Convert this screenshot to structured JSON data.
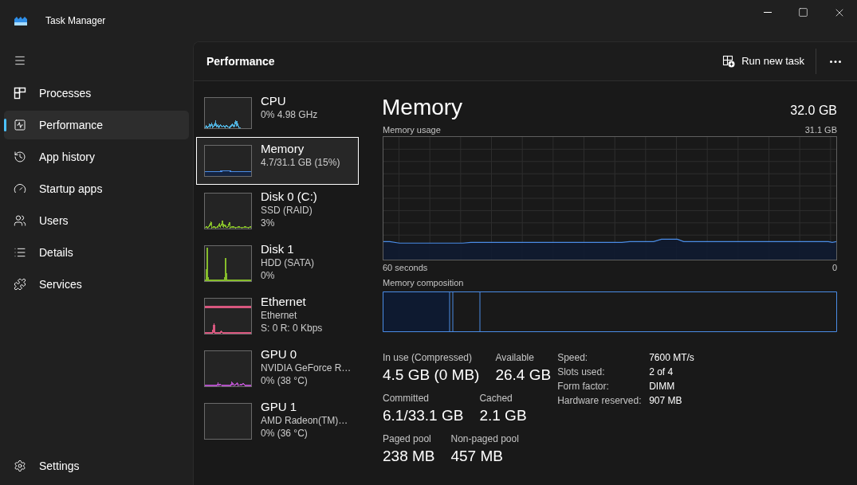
{
  "window": {
    "title": "Task Manager"
  },
  "sidebar": {
    "items": [
      {
        "label": "Processes",
        "selected": false
      },
      {
        "label": "Performance",
        "selected": true
      },
      {
        "label": "App history",
        "selected": false
      },
      {
        "label": "Startup apps",
        "selected": false
      },
      {
        "label": "Users",
        "selected": false
      },
      {
        "label": "Details",
        "selected": false
      },
      {
        "label": "Services",
        "selected": false
      }
    ],
    "settings": {
      "label": "Settings"
    }
  },
  "header": {
    "title": "Performance",
    "run_new_task": {
      "label": "Run new task"
    }
  },
  "devices": [
    {
      "name": "CPU",
      "details": [
        "0% 4.98 GHz"
      ],
      "color": "#4fb0dc",
      "selected": false
    },
    {
      "name": "Memory",
      "details": [
        "4.7/31.1 GB (15%)"
      ],
      "color": "#4a8ce6",
      "selected": true
    },
    {
      "name": "Disk 0 (C:)",
      "details": [
        "SSD (RAID)",
        "3%"
      ],
      "color": "#86bd2b",
      "selected": false
    },
    {
      "name": "Disk 1",
      "details": [
        "HDD (SATA)",
        "0%"
      ],
      "color": "#86bd2b",
      "selected": false
    },
    {
      "name": "Ethernet",
      "details": [
        "Ethernet",
        "S: 0 R: 0 Kbps"
      ],
      "color": "#d9577f",
      "selected": false
    },
    {
      "name": "GPU 0",
      "details": [
        "NVIDIA GeForce R…",
        "0% (38 °C)"
      ],
      "color": "#b150c4",
      "selected": false
    },
    {
      "name": "GPU 1",
      "details": [
        "AMD Radeon(TM)…",
        "0% (36 °C)"
      ],
      "selected": false
    }
  ],
  "detail": {
    "title": "Memory",
    "total": "32.0 GB",
    "usage_graph": {
      "label": "Memory usage",
      "max_label": "31.1 GB",
      "start_label": "60 seconds",
      "end_label": "0"
    },
    "composition": {
      "label": "Memory composition"
    },
    "stats": [
      {
        "items": [
          {
            "label": "In use (Compressed)",
            "value": "4.5 GB (0 MB)"
          },
          {
            "label": "Available",
            "value": "26.4 GB"
          }
        ]
      },
      {
        "items": [
          {
            "label": "Committed",
            "value": "6.1/33.1 GB"
          },
          {
            "label": "Cached",
            "value": "2.1 GB"
          }
        ]
      },
      {
        "items": [
          {
            "label": "Paged pool",
            "value": "238 MB"
          },
          {
            "label": "Non-paged pool",
            "value": "457 MB"
          }
        ]
      }
    ],
    "properties": [
      {
        "label": "Speed:",
        "value": "7600 MT/s"
      },
      {
        "label": "Slots used:",
        "value": "2 of 4"
      },
      {
        "label": "Form factor:",
        "value": "DIMM"
      },
      {
        "label": "Hardware reserved:",
        "value": "907 MB"
      }
    ]
  }
}
